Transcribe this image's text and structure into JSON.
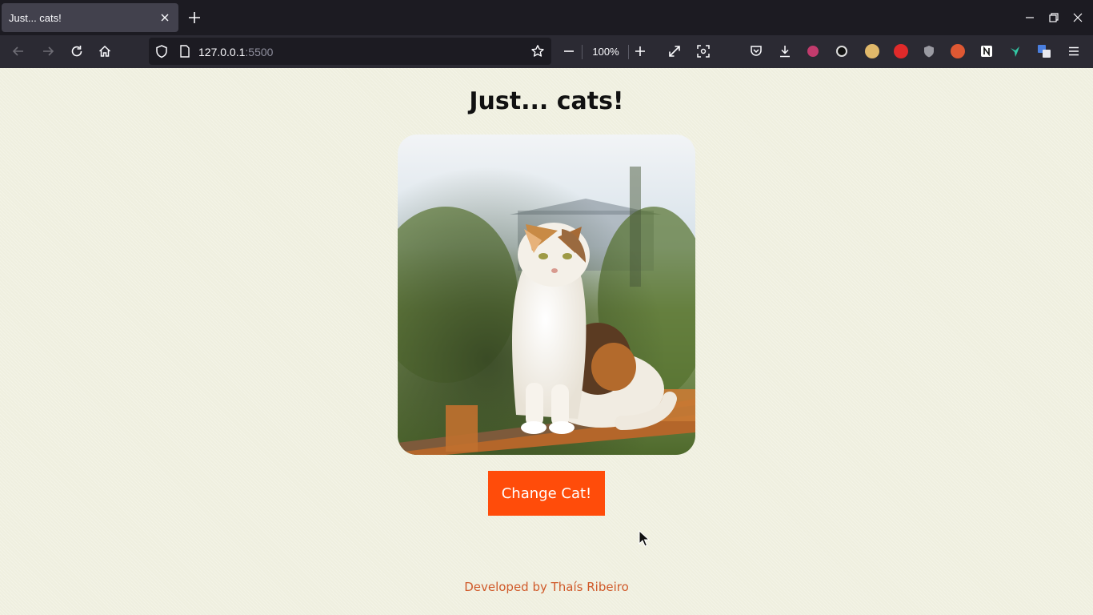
{
  "browser": {
    "tab": {
      "title": "Just... cats!"
    },
    "url": {
      "host": "127.0.0.1",
      "port": ":5500"
    },
    "zoom": "100%",
    "colors": {
      "tab_strip": "#1c1b22",
      "toolbar": "#2b2a33",
      "active_tab": "#42414d"
    },
    "toolbar_icons": [
      "back-icon",
      "forward-icon",
      "reload-icon",
      "home-icon",
      "shield-icon",
      "page-icon",
      "bookmark-star-icon",
      "zoom-out-icon",
      "zoom-in-icon",
      "fullscreen-icon",
      "screenshot-icon",
      "pocket-icon",
      "download-icon",
      "menu-icon"
    ]
  },
  "page": {
    "title": "Just... cats!",
    "button_label": "Change Cat!",
    "footer": "Developed by Thaís Ribeiro",
    "colors": {
      "background": "#efefdf",
      "button": "#ff4c0a",
      "footer_text": "#d05a2a"
    }
  }
}
